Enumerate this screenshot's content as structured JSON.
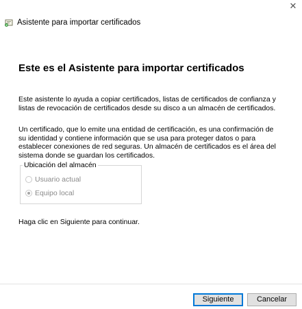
{
  "window": {
    "title": "Asistente para importar certificados",
    "close_glyph": "✕",
    "icon": "certificate-icon"
  },
  "main": {
    "heading": "Este es el Asistente para importar certificados",
    "paragraph1": "Este asistente lo ayuda a copiar certificados, listas de certificados de confianza y listas de revocación de certificados desde su disco a un almacén de certificados.",
    "paragraph2": "Un certificado, que lo emite una entidad de certificación, es una confirmación de su identidad y contiene información que se usa para proteger datos o para establecer conexiones de red seguras. Un almacén de certificados es el área del sistema donde se guardan los certificados."
  },
  "store_location": {
    "legend": "Ubicación del almacén",
    "options": [
      {
        "label": "Usuario actual",
        "checked": false,
        "enabled": false
      },
      {
        "label": "Equipo local",
        "checked": true,
        "enabled": false
      }
    ]
  },
  "footer": {
    "instruction": "Haga clic en Siguiente para continuar.",
    "next_label": "Siguiente",
    "cancel_label": "Cancelar"
  },
  "colors": {
    "accent": "#0078d7",
    "disabled_text": "#8a8a8a",
    "button_bg": "#e1e1e1"
  }
}
